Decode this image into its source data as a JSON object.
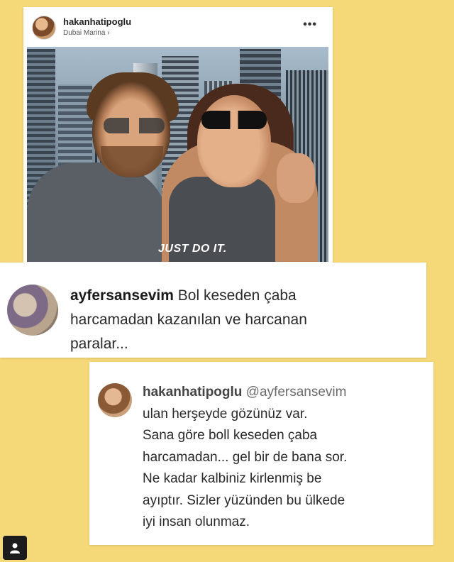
{
  "post": {
    "username": "hakanhatipoglu",
    "location": "Dubai Marina ›",
    "more_icon": "more-horizontal-icon",
    "more_glyph": "•••",
    "photo_shirt_text": "JUST DO IT."
  },
  "comment": {
    "username": "ayfersansevim",
    "line1": " Bol keseden çaba",
    "line2": "harcamadan kazanılan ve harcanan",
    "line3": "paralar..."
  },
  "reply": {
    "username": "hakanhatipoglu",
    "mention": " @ayfersansevim",
    "lines": [
      "ulan herşeyde gözünüz var.",
      "Sana göre boll keseden çaba",
      "harcamadan... gel bir de bana sor.",
      "Ne kadar kalbiniz kirlenmiş be",
      "ayıptır. Sizler yüzünden bu ülkede",
      "iyi insan olunmaz."
    ]
  },
  "badge": {
    "icon": "person-icon",
    "glyph": "👤"
  }
}
